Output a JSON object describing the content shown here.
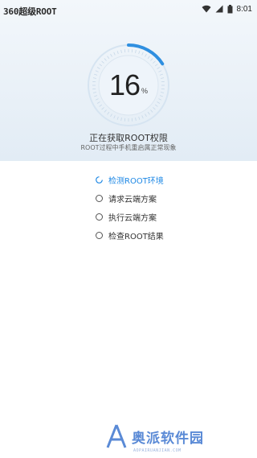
{
  "app": {
    "title": "360超级ROOT"
  },
  "statusbar": {
    "time": "8:01",
    "icons": [
      "wifi-icon",
      "signal-icon",
      "battery-icon"
    ]
  },
  "progress": {
    "value": 16,
    "percent_sign": "%",
    "fraction": 0.16
  },
  "status": {
    "headline": "正在获取ROOT权限",
    "subline": "ROOT过程中手机重启属正常现象"
  },
  "steps": [
    {
      "label": "检测ROOT环境",
      "state": "active"
    },
    {
      "label": "请求云端方案",
      "state": "pending"
    },
    {
      "label": "执行云端方案",
      "state": "pending"
    },
    {
      "label": "检查ROOT结果",
      "state": "pending"
    }
  ],
  "watermark": {
    "text": "奥派软件园",
    "url": "AOPAIRUANJIAN.COM"
  },
  "colors": {
    "accent": "#1e88e5",
    "header_bg": "#e9f0f7",
    "ring_track": "#cfe0ef"
  }
}
